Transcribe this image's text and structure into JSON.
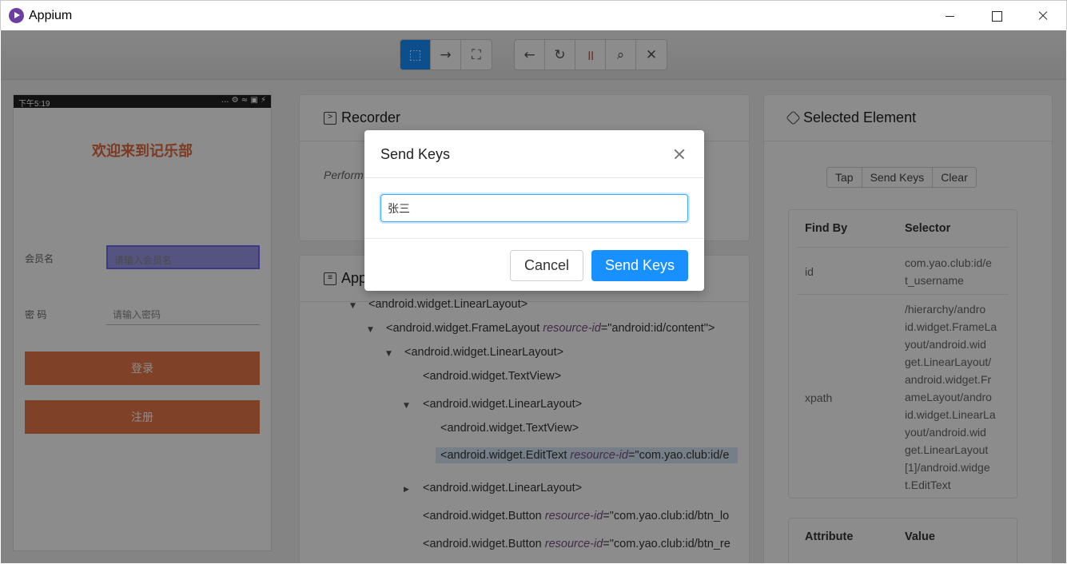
{
  "window": {
    "title": "Appium"
  },
  "device": {
    "status_time": "下午5:19",
    "status_icons": "... ⚙ ≈ ▣ ⚡",
    "welcome": "欢迎来到记乐部",
    "member_label": "会员名",
    "member_placeholder": "请输入会员名",
    "password_label": "密  码",
    "password_placeholder": "请输入密码",
    "login_button": "登录",
    "register_button": "注册"
  },
  "recorder": {
    "title": "Recorder",
    "text": "Perform"
  },
  "app_source": {
    "title": "App",
    "tree": [
      {
        "tag": "<android.widget.LinearLayout>",
        "attr": "",
        "val": ""
      },
      {
        "tag": "<android.widget.FrameLayout ",
        "attr": "resource-id",
        "val": "=\"android:id/content\">"
      },
      {
        "tag": "<android.widget.LinearLayout>",
        "attr": "",
        "val": ""
      },
      {
        "tag": "<android.widget.TextView>",
        "attr": "",
        "val": ""
      },
      {
        "tag": "<android.widget.LinearLayout>",
        "attr": "",
        "val": ""
      },
      {
        "tag": "<android.widget.TextView>",
        "attr": "",
        "val": ""
      },
      {
        "tag": "<android.widget.EditText ",
        "attr": "resource-id",
        "val": "=\"com.yao.club:id/e"
      },
      {
        "tag": "<android.widget.LinearLayout>",
        "attr": "",
        "val": ""
      },
      {
        "tag": "<android.widget.Button ",
        "attr": "resource-id",
        "val": "=\"com.yao.club:id/btn_lo"
      },
      {
        "tag": "<android.widget.Button ",
        "attr": "resource-id",
        "val": "=\"com.yao.club:id/btn_re"
      }
    ]
  },
  "selected_element": {
    "title": "Selected Element",
    "actions": [
      "Tap",
      "Send Keys",
      "Clear"
    ],
    "find_by_header": "Find By",
    "selector_header": "Selector",
    "rows": [
      {
        "by": "id",
        "lines": [
          "com.yao.club:id/e",
          "t_username"
        ]
      },
      {
        "by": "xpath",
        "lines": [
          "/hierarchy/andro",
          "id.widget.FrameLa",
          "yout/android.wid",
          "get.LinearLayout/",
          "android.widget.Fr",
          "ameLayout/andro",
          "id.widget.LinearLa",
          "yout/android.wid",
          "get.LinearLayout",
          "[1]/android.widge",
          "t.EditText"
        ]
      }
    ],
    "attribute_header": "Attribute",
    "value_header": "Value"
  },
  "modal": {
    "title": "Send Keys",
    "input_value": "张三",
    "cancel": "Cancel",
    "send": "Send Keys"
  },
  "colors": {
    "accent": "#1890ff",
    "device_button": "#e8784a"
  }
}
